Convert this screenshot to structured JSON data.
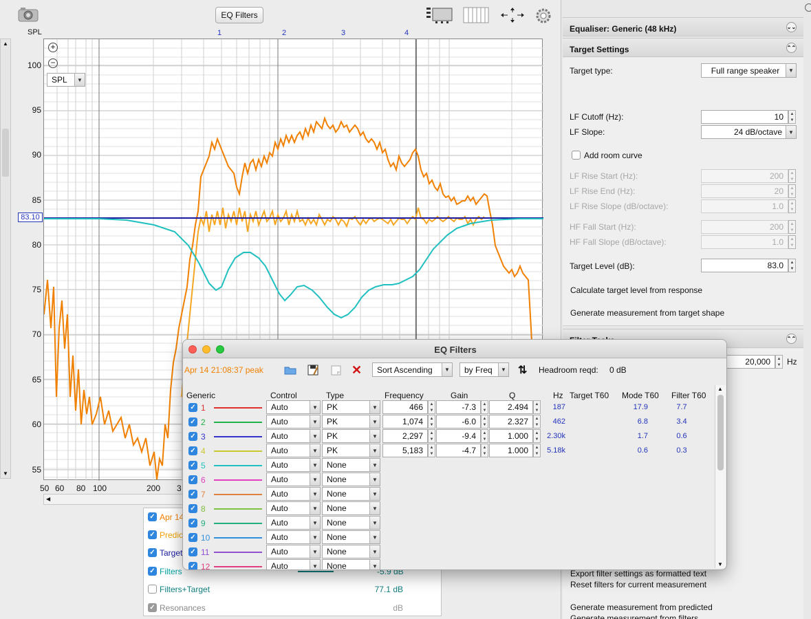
{
  "toolbar": {
    "eq_filters_button": "EQ Filters"
  },
  "graph": {
    "y_unit": "SPL",
    "y_ticks": [
      "100",
      "95",
      "90",
      "85",
      "80",
      "75",
      "70",
      "65",
      "60",
      "55"
    ],
    "x_ticks": [
      "50",
      "60",
      "80",
      "100",
      "200",
      "3"
    ],
    "mode_markers": [
      "1",
      "2",
      "3",
      "4"
    ],
    "target_value": "83.10",
    "trace_selector": "SPL"
  },
  "legend": [
    {
      "label": "Apr 14",
      "checked": true,
      "color": "#f08000",
      "value": ""
    },
    {
      "label": "Predic",
      "checked": true,
      "color": "#f08000",
      "value": ""
    },
    {
      "label": "Target",
      "checked": true,
      "color": "#1a1aa0",
      "value": ""
    },
    {
      "label": "Filters",
      "checked": true,
      "color": "#00aaaa",
      "value": "-5.9 dB"
    },
    {
      "label": "Filters+Target",
      "checked": false,
      "color": "#117f7f",
      "value": "77.1 dB"
    },
    {
      "label": "Resonances",
      "checked": true,
      "color": "#999999",
      "value": "dB"
    }
  ],
  "right_panel": {
    "equaliser_title": "Equaliser: Generic (48 kHz)",
    "target_settings_title": "Target Settings",
    "target_type_label": "Target type:",
    "target_type_value": "Full range speaker",
    "lf_cutoff_label": "LF Cutoff (Hz):",
    "lf_cutoff_value": "10",
    "lf_slope_label": "LF Slope:",
    "lf_slope_value": "24 dB/octave",
    "add_room_curve_label": "Add room curve",
    "lf_rise_start_label": "LF Rise Start (Hz):",
    "lf_rise_start_value": "200",
    "lf_rise_end_label": "LF Rise End (Hz):",
    "lf_rise_end_value": "20",
    "lf_rise_slope_label": "LF Rise Slope (dB/octave):",
    "lf_rise_slope_value": "1.0",
    "hf_fall_start_label": "HF Fall Start (Hz):",
    "hf_fall_start_value": "200",
    "hf_fall_slope_label": "HF Fall Slope (dB/octave):",
    "hf_fall_slope_value": "1.0",
    "target_level_label": "Target Level (dB):",
    "target_level_value": "83.0",
    "calc_target_link": "Calculate target level from response",
    "gen_measurement_link": "Generate measurement from target shape",
    "filter_tasks_title": "Filter Tasks",
    "freq_limit_value": "20,000",
    "freq_limit_unit": "Hz",
    "export_link": "Export filter settings as formatted text",
    "reset_link": "Reset filters for current measurement",
    "gen_predicted_link": "Generate measurement from predicted",
    "gen_filters_link": "Generate measurement from filters"
  },
  "eq_window": {
    "title": "EQ Filters",
    "measurement_name": "Apr 14 21:08:37 peak",
    "sort_value": "Sort Ascending",
    "sort_by_value": "by Freq",
    "headroom_label": "Headroom reqd:",
    "headroom_value": "0 dB",
    "columns": {
      "generic": "Generic",
      "control": "Control",
      "type": "Type",
      "frequency": "Frequency",
      "gain": "Gain",
      "q": "Q",
      "hz": "Hz",
      "target_t60": "Target T60",
      "mode_t60": "Mode T60",
      "filter_t60": "Filter T60"
    },
    "filters": [
      {
        "num": "1",
        "color": "#e03030",
        "control": "Auto",
        "type": "PK",
        "frequency": "466",
        "gain": "-7.3",
        "q": "2.494",
        "hz": "187",
        "mode_t60": "17.9",
        "filter_t60": "7.7"
      },
      {
        "num": "2",
        "color": "#22b04a",
        "control": "Auto",
        "type": "PK",
        "frequency": "1,074",
        "gain": "-6.0",
        "q": "2.327",
        "hz": "462",
        "mode_t60": "6.8",
        "filter_t60": "3.4"
      },
      {
        "num": "3",
        "color": "#3333cc",
        "control": "Auto",
        "type": "PK",
        "frequency": "2,297",
        "gain": "-9.4",
        "q": "1.000",
        "hz": "2.30k",
        "mode_t60": "1.7",
        "filter_t60": "0.6"
      },
      {
        "num": "4",
        "color": "#c8c830",
        "control": "Auto",
        "type": "PK",
        "frequency": "5,183",
        "gain": "-4.7",
        "q": "1.000",
        "hz": "5.18k",
        "mode_t60": "0.6",
        "filter_t60": "0.3"
      },
      {
        "num": "5",
        "color": "#20c0c0",
        "control": "Auto",
        "type": "None",
        "frequency": "",
        "gain": "",
        "q": "",
        "hz": "",
        "mode_t60": "",
        "filter_t60": ""
      },
      {
        "num": "6",
        "color": "#e040c0",
        "control": "Auto",
        "type": "None",
        "frequency": "",
        "gain": "",
        "q": "",
        "hz": "",
        "mode_t60": "",
        "filter_t60": ""
      },
      {
        "num": "7",
        "color": "#e08040",
        "control": "Auto",
        "type": "None",
        "frequency": "",
        "gain": "",
        "q": "",
        "hz": "",
        "mode_t60": "",
        "filter_t60": ""
      },
      {
        "num": "8",
        "color": "#80c040",
        "control": "Auto",
        "type": "None",
        "frequency": "",
        "gain": "",
        "q": "",
        "hz": "",
        "mode_t60": "",
        "filter_t60": ""
      },
      {
        "num": "9",
        "color": "#20b080",
        "control": "Auto",
        "type": "None",
        "frequency": "",
        "gain": "",
        "q": "",
        "hz": "",
        "mode_t60": "",
        "filter_t60": ""
      },
      {
        "num": "10",
        "color": "#3090e0",
        "control": "Auto",
        "type": "None",
        "frequency": "",
        "gain": "",
        "q": "",
        "hz": "",
        "mode_t60": "",
        "filter_t60": ""
      },
      {
        "num": "11",
        "color": "#9050d0",
        "control": "Auto",
        "type": "None",
        "frequency": "",
        "gain": "",
        "q": "",
        "hz": "",
        "mode_t60": "",
        "filter_t60": ""
      },
      {
        "num": "12",
        "color": "#e04080",
        "control": "Auto",
        "type": "None",
        "frequency": "",
        "gain": "",
        "q": "",
        "hz": "",
        "mode_t60": "",
        "filter_t60": ""
      }
    ]
  }
}
